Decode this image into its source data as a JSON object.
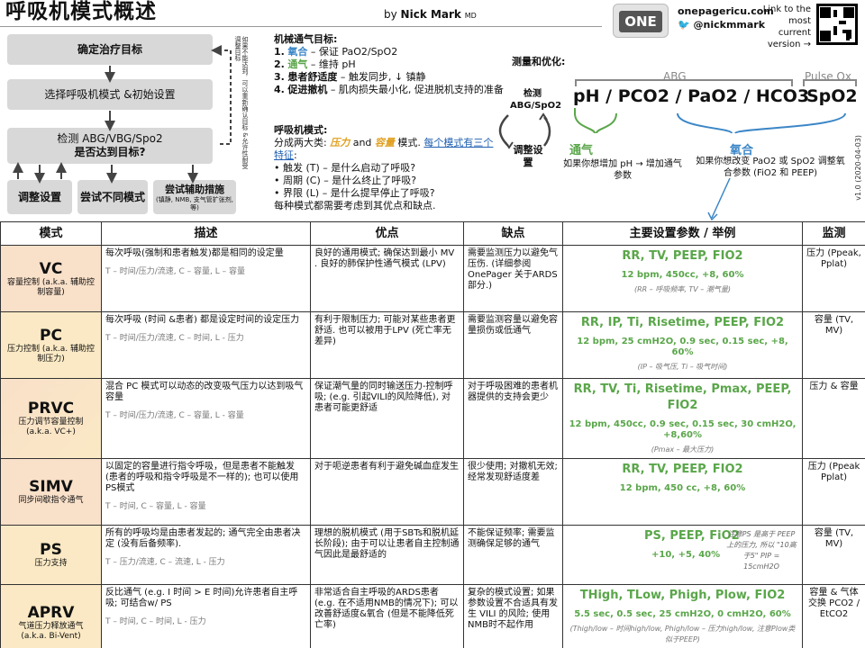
{
  "header": {
    "title": "呼吸机模式概述",
    "author_prefix": "by",
    "author": "Nick Mark",
    "author_suffix": "MD",
    "one_logo": "ONE",
    "site": "onepagericu.com",
    "twitter": "🐦 @nickmmark",
    "link_text": "Link to the most current version →"
  },
  "flow": {
    "box1": "确定治疗目标",
    "box2": "选择呼吸机模式 &初始设置",
    "box3_line1": "检测 ABG/VBG/Spo2",
    "box3_line2": "是否达到目标?",
    "box4": "调整设置",
    "box5": "尝试不同模式",
    "box6": "尝试辅助措施",
    "box6_sub": "(镇静, NMB, 支气管扩张剂, 等)",
    "side_text": "如果不能达到，可以重新确认目标 &允许性耐受调整目标"
  },
  "goals": {
    "heading": "机械通气目标:",
    "items": [
      {
        "num": "1.",
        "key": "氧合",
        "text": " – 保证 PaO2/SpO2"
      },
      {
        "num": "2.",
        "key": "通气",
        "text": " – 维持 pH"
      },
      {
        "num": "3.",
        "key": "患者舒适度",
        "text": " – 触发同步, ↓ 镇静"
      },
      {
        "num": "4.",
        "key": "促进撤机",
        "text": " – 肌肉损失最小化, 促进脱机支持的准备"
      }
    ]
  },
  "modes_intro": {
    "heading": "呼吸机模式:",
    "line1_pre": "分成两大类: ",
    "pressure": "压力",
    "and": " and ",
    "volume": "容量",
    "line1_post": " 模式. ",
    "link": "每个模式有三个 特征",
    "colon": ":",
    "trigger": "触发 (T) – 是什么启动了呼吸?",
    "cycle": "周期 (C) – 是什么终止了呼吸?",
    "limit": "界限 (L) – 是什么提早停止了呼吸?",
    "footer": "每种模式都需要考虑到其优点和缺点."
  },
  "measure": {
    "title": "测量和优化:",
    "monitor": "检测 ABG/SpO2",
    "adjust": "调整设置",
    "abg_label": "ABG",
    "pox_label": "Pulse Ox",
    "pH": "pH",
    "pco2": "PCO2",
    "pao2": "PaO2",
    "hco3": "HCO3",
    "spo2": "SpO2",
    "vent_title": "通气",
    "vent_desc": "如果你想增加 pH → 增加通气参数",
    "oxy_title": "氧合",
    "oxy_desc": "如果你想改变 PaO2 或 SpO2 调整氧合参数 (FiO2 和 PEEP)",
    "version": "v1.0 (2020-04-03)"
  },
  "table": {
    "headers": [
      "模式",
      "描述",
      "优点",
      "缺点",
      "主要设置参数 / 举例",
      "监测"
    ],
    "rows": [
      {
        "mode": "VC",
        "sub": "容量控制 (a.k.a. 辅助控制容量)",
        "desc": "每次呼吸(强制和患者触发)都是相同的设定量",
        "tcl": "T – 时间/压力/流速, C – 容量, L – 容量",
        "pros": "良好的通用模式; 确保达到最小 MV . 良好的肺保护性通气模式 (LPV)",
        "cons": "需要监测压力以避免气压伤. (详细参阅 OnePager 关于ARDS部分.)",
        "params": "RR, TV, PEEP, FIO2",
        "example": "12 bpm, 450cc, +8, 60%",
        "note": "(RR – 呼吸频率, TV – 潮气量)",
        "monitor": "压力 (Ppeak, Pplat)"
      },
      {
        "mode": "PC",
        "sub": "压力控制 (a.k.a. 辅助控制压力)",
        "desc": "每次呼吸 (时间 &患者) 都是设定时间的设定压力",
        "tcl": "T – 时间/压力/流速, C – 时间, L - 压力",
        "pros": "有利于限制压力; 可能对某些患者更舒适. 也可以被用于LPV (死亡率无差异)",
        "cons": "需要监测容量以避免容量损伤或低通气",
        "params": "RR, IP, Ti, Risetime, PEEP, FIO2",
        "example": "12 bpm, 25 cmH2O, 0.9 sec, 0.15 sec, +8, 60%",
        "note": "(IP – 吸气压, Ti – 吸气时间)",
        "monitor": "容量 (TV, MV)"
      },
      {
        "mode": "PRVC",
        "sub": "压力调节容量控制 (a.k.a. VC+)",
        "desc": "混合 PC 模式可以动态的改变吸气压力以达到吸气容量",
        "tcl": "T – 时间/压力/流速, C – 容量, L - 容量",
        "pros": "保证潮气量的同时输送压力-控制呼吸; (e.g. 引起VILI的风险降低), 对患者可能更舒适",
        "cons": "对于呼吸困难的患者机器提供的支持会更少",
        "params": "RR, TV, Ti, Risetime, Pmax, PEEP, FIO2",
        "example": "12 bpm, 450cc, 0.9 sec, 0.15 sec, 30 cmH2O, +8,60%",
        "note": "(Pmax – 最大压力)",
        "monitor": "压力 & 容量"
      },
      {
        "mode": "SIMV",
        "sub": "同步间歇指令通气",
        "desc": "以固定的容量进行指令呼吸，但是患者不能触发 (患者的呼吸和指令呼吸是不一样的); 也可以使用 PS模式",
        "tcl": "T – 时间, C – 容量, L - 容量",
        "pros": "对于呃逆患者有利于避免碱血症发生",
        "cons": "很少使用; 对撤机无效; 经常发现舒适度差",
        "params": "RR, TV, PEEP, FIO2",
        "example": "12 bpm, 450 cc, +8, 60%",
        "note": "",
        "monitor": "压力 (Ppeak Pplat)"
      },
      {
        "mode": "PS",
        "sub": "压力支持",
        "desc": "所有的呼吸均是由患者发起的; 通气完全由患者决定 (没有后备频率).",
        "tcl": "T – 压力/流速, C – 流速, L - 压力",
        "pros": "理想的脱机模式 (用于SBTs和脱机延长阶段); 由于可以让患者自主控制通气因此是最舒适的",
        "cons": "不能保证频率; 需要监测确保足够的通气",
        "params": "PS, PEEP, FiO2",
        "example": "+10, +5, 40%",
        "note": "注意PS 是高于 PEEP 上的压力, 所以 \"10高于5\" PIP = 15cmH2O",
        "monitor": "容量 (TV, MV)"
      },
      {
        "mode": "APRV",
        "sub": "气道压力释放通气 (a.k.a. Bi-Vent)",
        "desc": "反比通气 (e.g. I 时间 > E 时间)允许患者自主呼吸; 可结合w/ PS",
        "tcl": "T – 时间, C – 时间, L - 压力",
        "pros": "非常适合自主呼吸的ARDS患者 (e.g. 在不适用NMB的情况下); 可以改善舒适度&氧合 (但是不能降低死亡率)",
        "cons": "复杂的模式设置; 如果参数设置不合适具有发生 VILI 的风险; 使用NMB时不起作用",
        "params": "THigh, TLow, Phigh, Plow, FIO2",
        "example": "5.5 sec, 0.5 sec, 25 cmH2O, 0 cmH2O, 60%",
        "note": "(Thigh/low – 时间high/low, Phigh/low – 压力high/low, 注意Plow类似于PEEP)",
        "monitor": "容量 & 气体交换 PCO2 / EtCO2"
      }
    ]
  },
  "colors": {
    "vent_green": "#5aa64a",
    "oxy_blue": "#3b86c7",
    "row_orange": "#f9e0c9",
    "row_yellow": "#fae9c4"
  }
}
